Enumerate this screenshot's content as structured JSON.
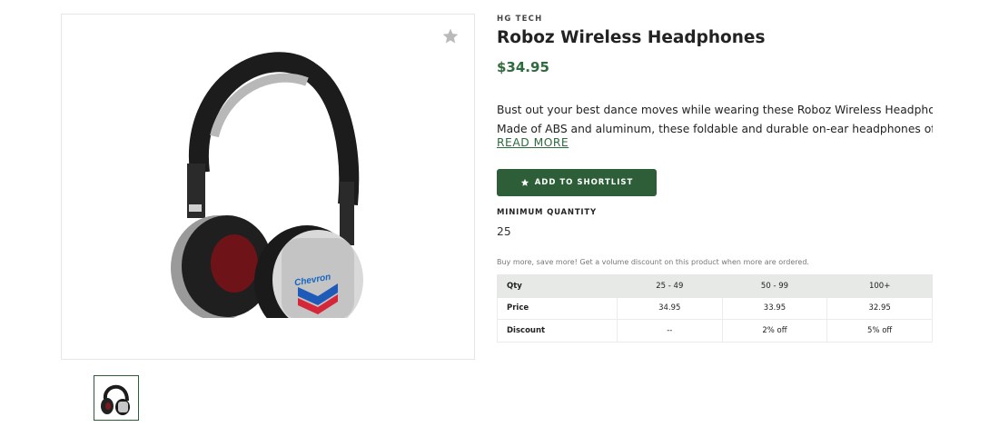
{
  "product": {
    "brand": "HG TECH",
    "title": "Roboz Wireless Headphones",
    "price": "$34.95",
    "description_line1": "Bust out your best dance moves while wearing these Roboz Wireless Headphones!",
    "description_line2": "Made of ABS and aluminum, these foldable and durable on-ear headphones offer...",
    "read_more": "READ MORE",
    "image_logo_text": "Chevron"
  },
  "actions": {
    "shortlist_label": "ADD TO SHORTLIST",
    "favorite_icon": "star-icon"
  },
  "minimum_quantity": {
    "label": "MINIMUM QUANTITY",
    "value": "25"
  },
  "volume": {
    "note": "Buy more, save more! Get a volume discount on this product when more are ordered.",
    "headers": [
      "Qty",
      "25 - 49",
      "50 - 99",
      "100+"
    ],
    "rows": [
      {
        "label": "Price",
        "values": [
          "34.95",
          "33.95",
          "32.95"
        ]
      },
      {
        "label": "Discount",
        "values": [
          "--",
          "2% off",
          "5% off"
        ]
      }
    ]
  },
  "colors": {
    "accent_green": "#2d5e38",
    "price_green": "#2f6b3d",
    "table_header_bg": "#e6e9e6"
  }
}
